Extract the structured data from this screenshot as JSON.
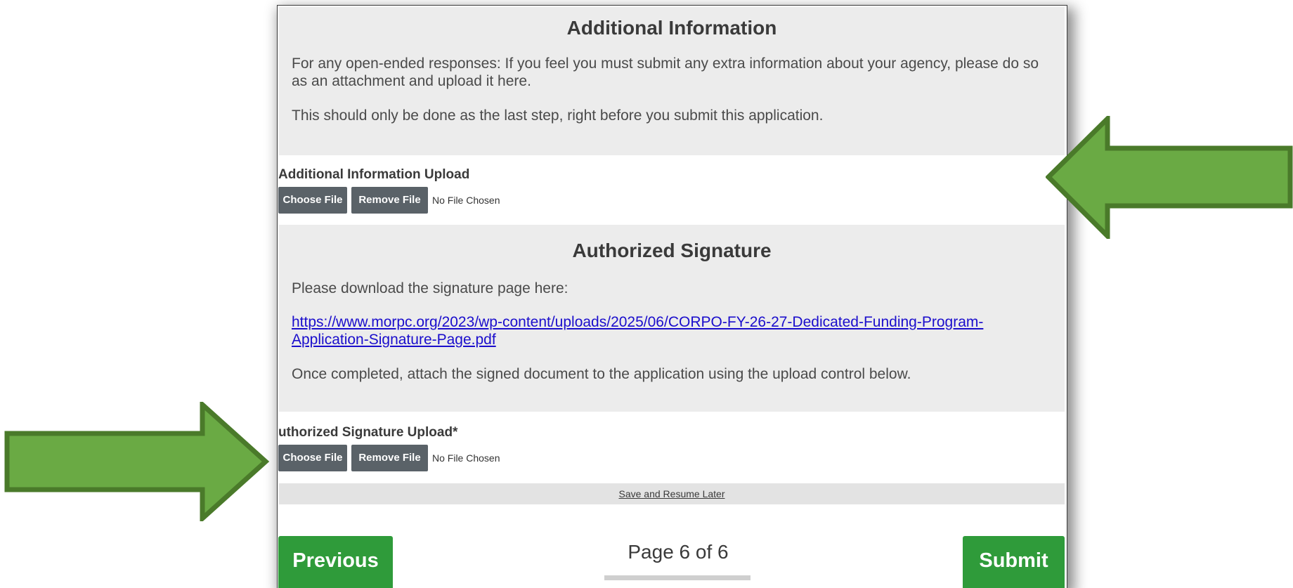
{
  "additional_info": {
    "title": "Additional Information",
    "para1": "For any open-ended responses: If you feel you must submit any extra information about your agency, please do so as an attachment and upload it here.",
    "para2": "This should only be done as the last step, right before you submit this application.",
    "upload_label": "Additional Information Upload",
    "choose_label": "Choose File",
    "remove_label": "Remove File",
    "file_status": "No File Chosen"
  },
  "authorized_signature": {
    "title": "Authorized Signature",
    "para1": "Please download the signature page here:",
    "link": "https://www.morpc.org/2023/wp-content/uploads/2025/06/CORPO-FY-26-27-Dedicated-Funding-Program-Application-Signature-Page.pdf",
    "para2": "Once completed, attach the signed document to the application using the upload control below.",
    "upload_label": "uthorized Signature Upload*",
    "choose_label": "Choose File",
    "remove_label": "Remove File",
    "file_status": "No File Chosen"
  },
  "footer": {
    "save_resume": "Save and Resume Later",
    "previous_label": "Previous",
    "page_indicator": "Page 6 of 6",
    "submit_label": "Submit"
  },
  "colors": {
    "arrow_fill": "#6aaa44",
    "arrow_stroke": "#4a7a2a",
    "button_green": "#2f9b3a",
    "button_dark": "#5a6268",
    "link": "#1a0dcc"
  },
  "icons": {
    "right_arrow": "arrow-right-annotation",
    "left_arrow": "arrow-left-annotation"
  }
}
